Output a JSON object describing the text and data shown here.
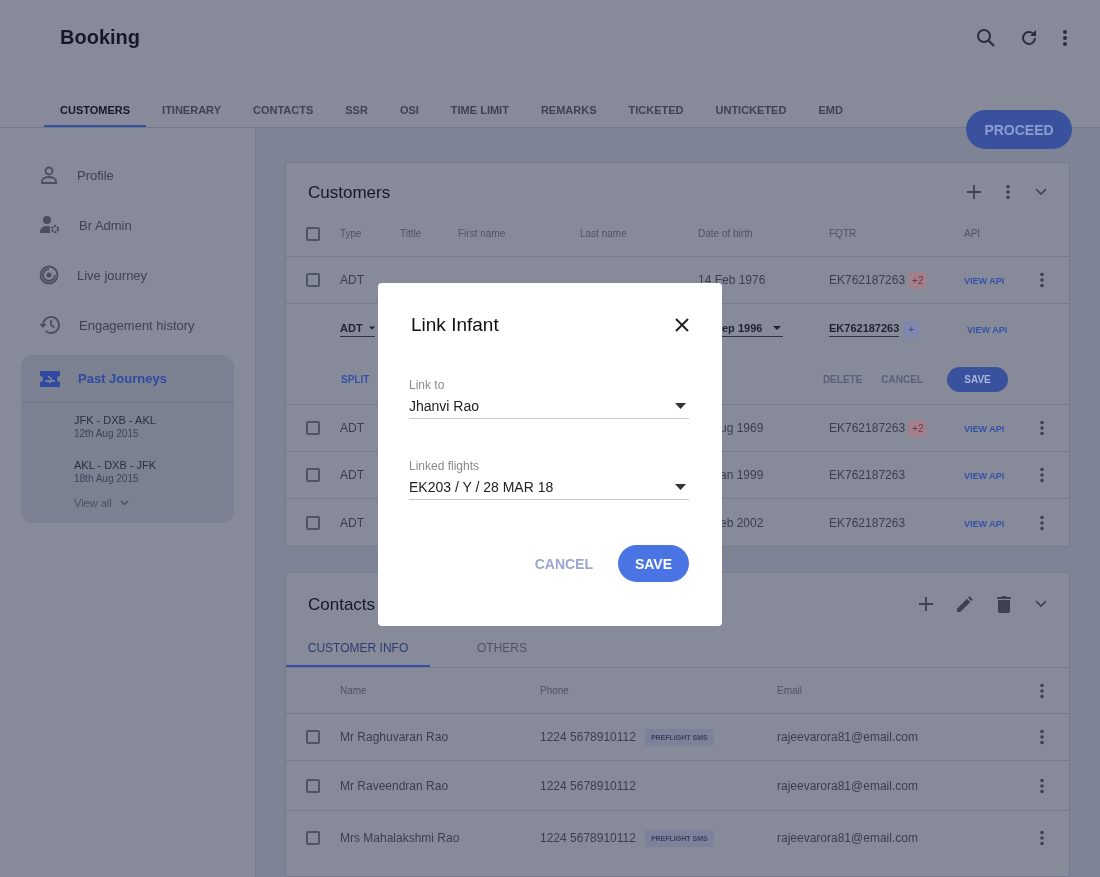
{
  "header": {
    "title": "Booking"
  },
  "tabs": [
    {
      "label": "CUSTOMERS",
      "selected": true
    },
    {
      "label": "ITINERARY",
      "selected": false
    },
    {
      "label": "CONTACTS",
      "selected": false
    },
    {
      "label": "SSR",
      "selected": false
    },
    {
      "label": "OSI",
      "selected": false
    },
    {
      "label": "TIME LIMIT",
      "selected": false
    },
    {
      "label": "REMARKS",
      "selected": false
    },
    {
      "label": "TICKETED",
      "selected": false
    },
    {
      "label": "UNTICKETED",
      "selected": false
    },
    {
      "label": "EMD",
      "selected": false
    }
  ],
  "proceed": "PROCEED",
  "sidebar": {
    "items": [
      {
        "label": "Profile",
        "kind": "person"
      },
      {
        "label": "Br Admin",
        "kind": "admin"
      },
      {
        "label": "Live journey",
        "kind": "live"
      },
      {
        "label": "Engagement history",
        "kind": "history"
      }
    ],
    "past_journeys": {
      "title": "Past Journeys",
      "trips": [
        {
          "route": "JFK - DXB - AKL",
          "date": "12th Aug 2015"
        },
        {
          "route": "AKL - DXB - JFK",
          "date": "18th Aug 2015"
        }
      ],
      "view_all": "View all"
    }
  },
  "customers": {
    "title": "Customers",
    "all_checked": false,
    "columns": [
      "Type",
      "Tittle",
      "First name",
      "Last name",
      "Date of birth",
      "FQTR",
      "API"
    ],
    "rows": [
      {
        "kind": "row",
        "checked": false,
        "type": "ADT",
        "dob": "14 Feb 1976",
        "fqtr": "EK762187263",
        "badge": {
          "text": "+2",
          "kind": "count"
        },
        "api": "VIEW API"
      },
      {
        "kind": "edit",
        "type": "ADT",
        "dob": "ep 1996",
        "fqtr": "EK762187263",
        "badge": {
          "text": "+",
          "kind": "add"
        },
        "api": "VIEW API",
        "split": "SPLIT",
        "delete": "DELETE",
        "cancel": "CANCEL",
        "save": "SAVE"
      },
      {
        "kind": "row",
        "checked": false,
        "type": "ADT",
        "dob": "ug 1969",
        "fqtr": "EK762187263",
        "badge": {
          "text": "+2",
          "kind": "count"
        },
        "api": "VIEW API"
      },
      {
        "kind": "row",
        "checked": false,
        "type": "ADT",
        "dob": "an 1999",
        "fqtr": "EK762187263",
        "api": "VIEW API"
      },
      {
        "kind": "row",
        "checked": false,
        "type": "ADT",
        "dob": "eb 2002",
        "fqtr": "EK762187263",
        "api": "VIEW API"
      }
    ]
  },
  "contacts": {
    "title": "Contacts",
    "tabs": [
      {
        "label": "CUSTOMER INFO",
        "selected": true
      },
      {
        "label": "OTHERS",
        "selected": false
      }
    ],
    "columns": [
      "Name",
      "Phone",
      "Email"
    ],
    "rows": [
      {
        "checked": false,
        "name": "Mr Raghuvaran Rao",
        "phone": "1224 5678910112",
        "tag": "PREFLIGHT SMS",
        "email": "rajeevarora81@email.com"
      },
      {
        "checked": false,
        "name": "Mr Raveendran Rao",
        "phone": "1224 5678910112",
        "email": "rajeevarora81@email.com"
      },
      {
        "checked": false,
        "name": "Mrs Mahalakshmi Rao",
        "phone": "1224 5678910112",
        "tag": "PREFLIGHT SMS",
        "email": "rajeevarora81@email.com"
      }
    ]
  },
  "dialog": {
    "title": "Link Infant",
    "fields": [
      {
        "label": "Link to",
        "value": "Jhanvi Rao"
      },
      {
        "label": "Linked flights",
        "value": "EK203 / Y / 28 MAR 18"
      }
    ],
    "buttons": [
      {
        "label": "CANCEL",
        "kind": "text"
      },
      {
        "label": "SAVE",
        "kind": "primary"
      }
    ]
  }
}
